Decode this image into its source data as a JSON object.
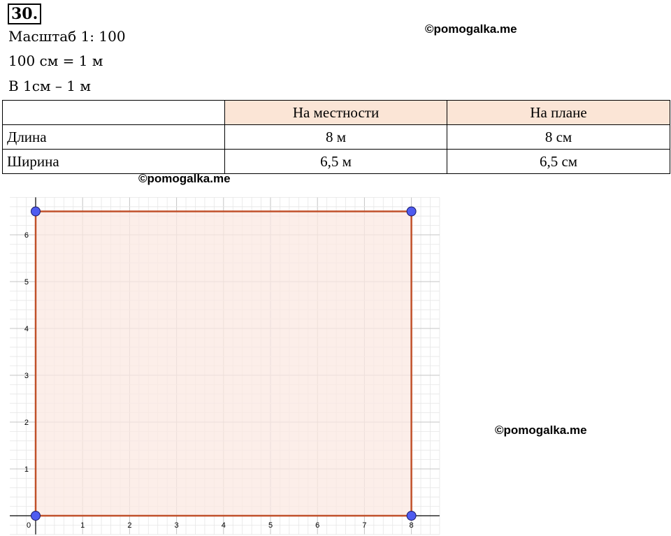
{
  "task_number": "30.",
  "lines": [
    "Масштаб 1: 100",
    "100 см  =  1 м",
    "В 1см – 1 м"
  ],
  "watermark": "©pomogalka.me",
  "table": {
    "headers": [
      "",
      "На местности",
      "На плане"
    ],
    "rows": [
      {
        "label": "Длина",
        "ground": "8 м",
        "plan": "8 см"
      },
      {
        "label": "Ширина",
        "ground": "6,5 м",
        "plan": "6,5 см"
      }
    ]
  },
  "chart_data": {
    "type": "scatter",
    "x_ticks": [
      "0",
      "1",
      "2",
      "3",
      "4",
      "5",
      "6",
      "7",
      "8"
    ],
    "y_ticks": [
      "1",
      "2",
      "3",
      "4",
      "5",
      "6"
    ],
    "xlim": [
      0,
      8.6
    ],
    "ylim": [
      0,
      6.8
    ],
    "grid": true,
    "rectangle": {
      "vertices": [
        [
          0,
          0
        ],
        [
          8,
          0
        ],
        [
          8,
          6.5
        ],
        [
          0,
          6.5
        ]
      ],
      "fill_color": "#fbe8e2",
      "edge_color": "#c0502a"
    },
    "point_color": "#4f5cf0"
  }
}
